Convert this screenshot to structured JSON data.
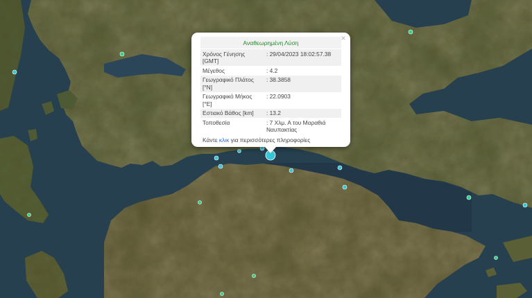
{
  "popup": {
    "title": "Αναθεωρημένη Λύση",
    "close_symbol": "×",
    "rows": [
      {
        "label": "Χρόνος Γένησης [GMT]",
        "value": ": 29/04/2023 18:02:57.38"
      },
      {
        "label": "Μέγεθος",
        "value": ": 4.2"
      },
      {
        "label": "Γεωγραφικό Πλάτος [°N]",
        "value": ": 38.3858"
      },
      {
        "label": "Γεωγραφικό Μήκος [°E]",
        "value": ": 22.0903"
      },
      {
        "label": "Εστιακό Βάθος [km]",
        "value": ": 13.2"
      },
      {
        "label": "Τοποθεσία",
        "value": ": 7 Χλμ. Α του Μαραθιά Ναυπακτίας"
      }
    ],
    "more_prefix": "Κάντε",
    "more_link": "κλικ",
    "more_suffix": "για περισσότερες πληροφορίες"
  },
  "colors": {
    "sea": "#26404f",
    "land": "#4f5b33",
    "land_dark": "#3b4a2a",
    "land_light": "#7a6a4a",
    "quake_cyan": "#36c6d8",
    "quake_green": "#2fd08a",
    "title_green": "#1f8a28",
    "link_blue": "#2a6fd6"
  },
  "map": {
    "type": "satellite",
    "main_event_magnitude": 4.2,
    "markers": [
      {
        "lat": 38.386,
        "lon": 22.09,
        "color": "cyan",
        "main": true
      }
    ]
  }
}
